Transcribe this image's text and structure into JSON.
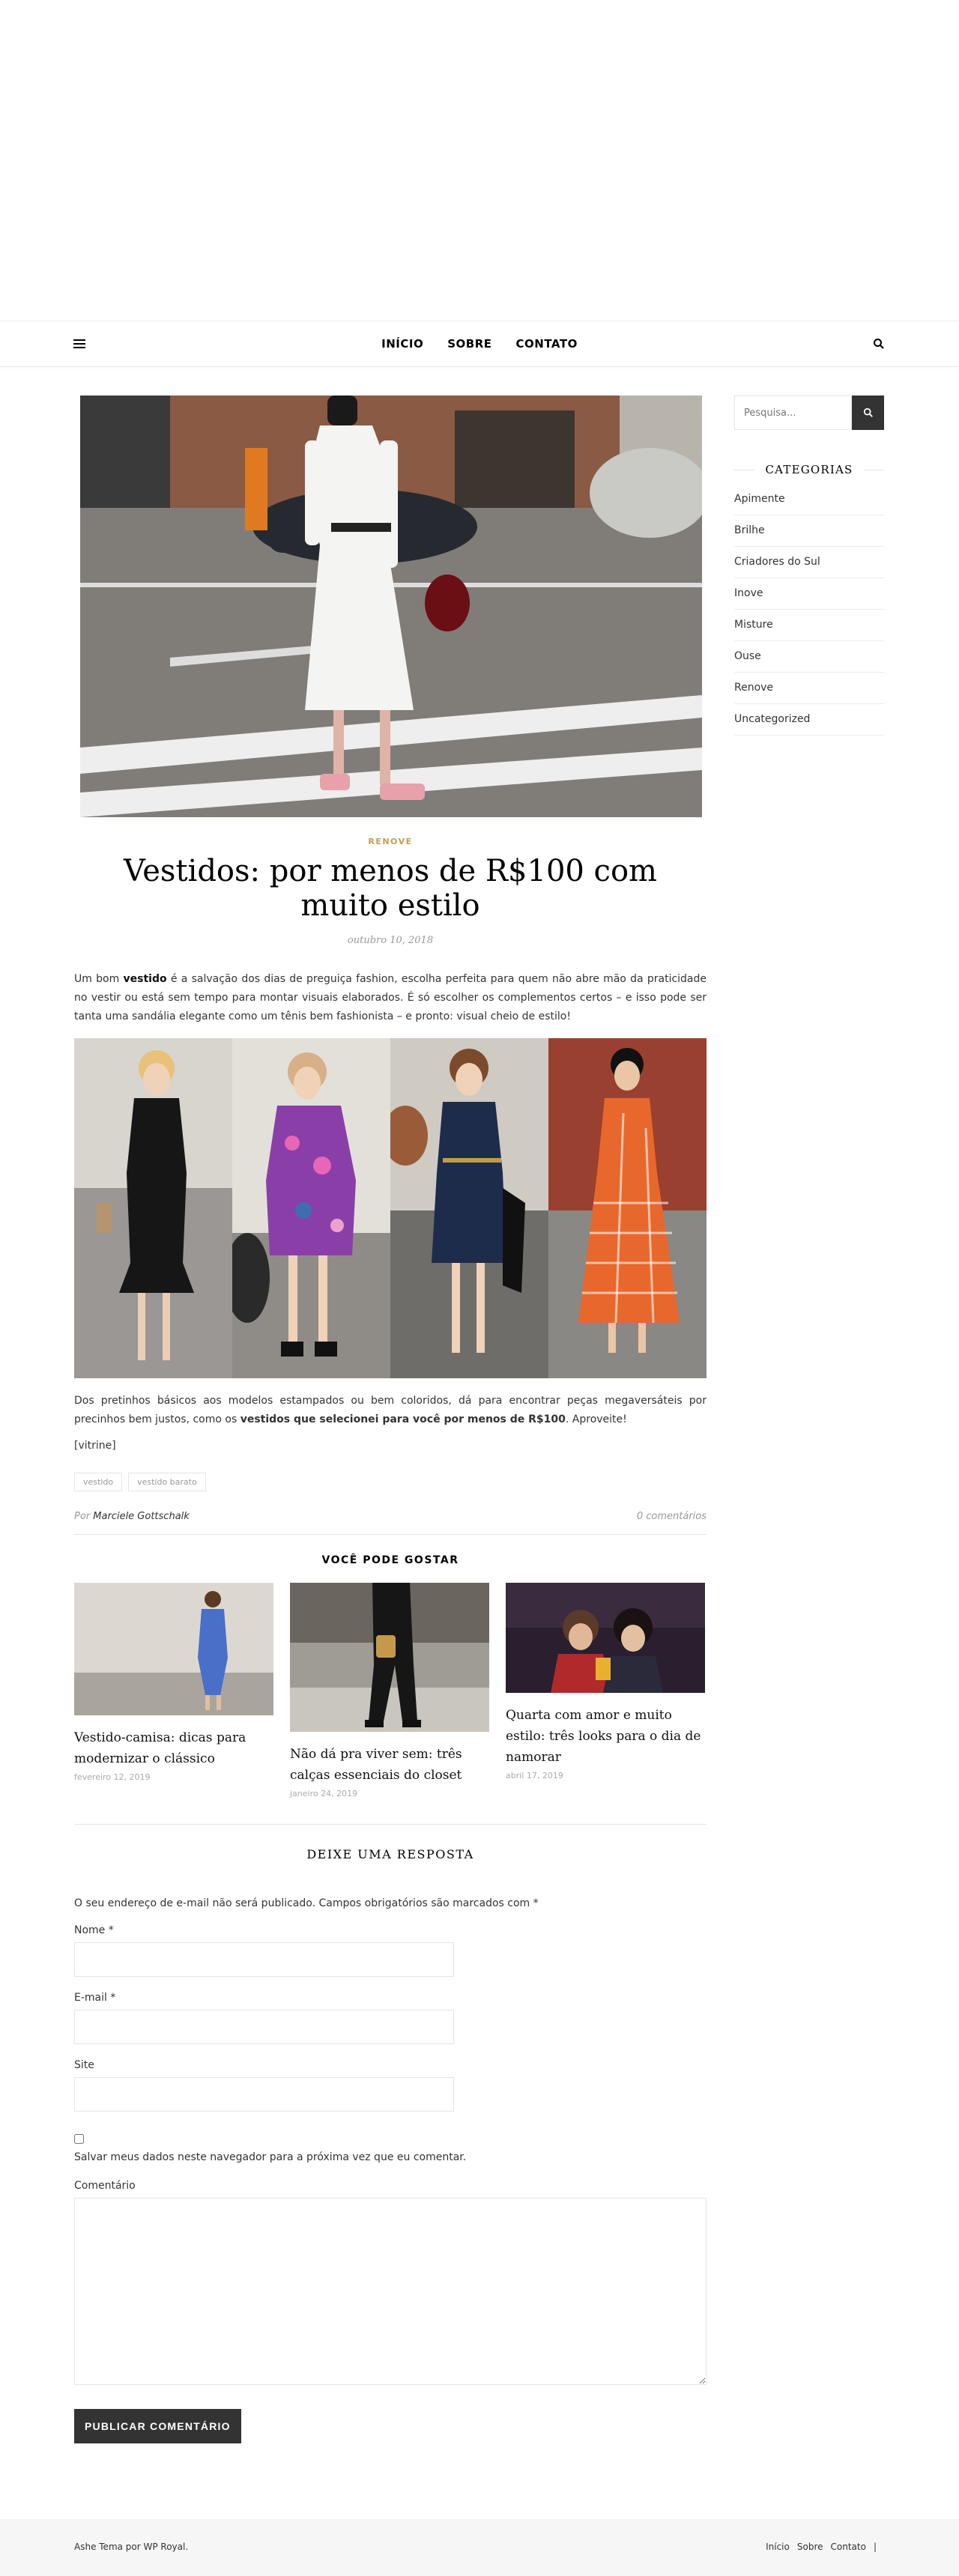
{
  "nav": {
    "items": [
      "INÍCIO",
      "SOBRE",
      "CONTATO"
    ]
  },
  "post": {
    "category": "RENOVE",
    "title": "Vestidos: por menos de R$100 com muito estilo",
    "date": "outubro 10, 2018",
    "intro_a": "Um bom ",
    "intro_bold": "vestido",
    "intro_b": " é a salvação dos dias de preguiça fashion, escolha perfeita para quem não abre mão da praticidade no vestir ou está sem tempo para montar visuais elaborados. É só escolher os complementos certos – e isso pode ser tanta uma sandália elegante como um tênis bem fashionista – e pronto: visual cheio de estilo!",
    "body2_a": "Dos pretinhos básicos aos modelos estampados ou bem coloridos, dá para encontrar peças megaversáteis por precinhos bem justos, como os ",
    "body2_bold": "vestidos que selecionei para você por menos de R$100",
    "body2_b": ". Aproveite!",
    "shortcode": "[vitrine]",
    "tags": [
      "vestido",
      "vestido barato"
    ],
    "author_prefix": "Por",
    "author": "Marciele Gottschalk",
    "comments": "0 comentários"
  },
  "related": {
    "heading": "VOCÊ PODE GOSTAR",
    "items": [
      {
        "title": "Vestido-camisa: dicas para modernizar o clássico",
        "date": "fevereiro 12, 2019"
      },
      {
        "title": "Não dá pra viver sem: três calças essenciais do closet",
        "date": "janeiro 24, 2019"
      },
      {
        "title": "Quarta com amor e muito estilo: três looks para o dia de namorar",
        "date": "abril 17, 2019"
      }
    ]
  },
  "reply": {
    "heading": "DEIXE UMA RESPOSTA",
    "notes": "O seu endereço de e-mail não será publicado. Campos obrigatórios são marcados com *",
    "name_label": "Nome *",
    "email_label": "E-mail *",
    "site_label": "Site",
    "save_label": "Salvar meus dados neste navegador para a próxima vez que eu comentar.",
    "comment_label": "Comentário",
    "submit": "PUBLICAR COMENTÁRIO"
  },
  "sidebar": {
    "search_placeholder": "Pesquisa...",
    "categories_title": "CATEGORIAS",
    "categories": [
      "Apimente",
      "Brilhe",
      "Criadores do Sul",
      "Inove",
      "Misture",
      "Ouse",
      "Renove",
      "Uncategorized"
    ]
  },
  "footer": {
    "copyright": "Ashe Tema por WP Royal.",
    "links": [
      "Início",
      "Sobre",
      "Contato"
    ],
    "separator": "|"
  },
  "icons": [
    "menu-icon",
    "search-icon"
  ],
  "colors": {
    "accent": "#ca9b52",
    "dark": "#333333"
  }
}
